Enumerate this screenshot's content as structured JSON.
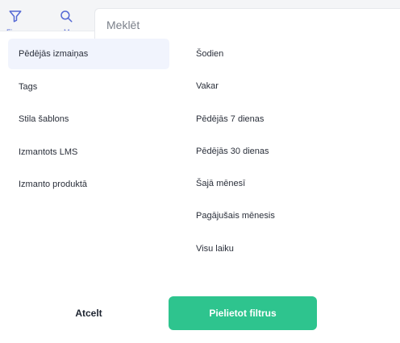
{
  "topbar": {
    "filter_tab_label": "Fi",
    "search_tab_label": "Me",
    "search": {
      "placeholder": "Meklēt",
      "value": ""
    }
  },
  "categories": [
    {
      "label": "Pēdējās izmaiņas",
      "active": true
    },
    {
      "label": "Tags"
    },
    {
      "label": "Stila šablons"
    },
    {
      "label": "Izmantots LMS"
    },
    {
      "label": "Izmanto produktā"
    }
  ],
  "options": [
    {
      "label": "Šodien"
    },
    {
      "label": "Vakar"
    },
    {
      "label": "Pēdējās 7 dienas"
    },
    {
      "label": "Pēdējās 30 dienas"
    },
    {
      "label": "Šajā mēnesī"
    },
    {
      "label": "Pagājušais mēnesis"
    },
    {
      "label": "Visu laiku"
    }
  ],
  "footer": {
    "cancel_label": "Atcelt",
    "apply_label": "Pielietot filtrus"
  },
  "colors": {
    "accent": "#5468d4",
    "apply_button": "#2ec48e",
    "active_row": "#f1f4fd",
    "topbar": "#f4f5f7"
  }
}
